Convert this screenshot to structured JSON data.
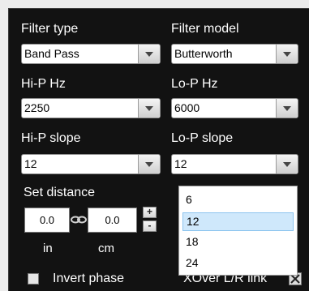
{
  "filter_type": {
    "label": "Filter type",
    "value": "Band Pass"
  },
  "filter_model": {
    "label": "Filter model",
    "value": "Butterworth"
  },
  "hip_hz": {
    "label": "Hi-P Hz",
    "value": "2250"
  },
  "lop_hz": {
    "label": "Lo-P Hz",
    "value": "6000"
  },
  "hip_slope": {
    "label": "Hi-P slope",
    "value": "12"
  },
  "lop_slope": {
    "label": "Lo-P slope",
    "value": "12",
    "options": [
      "6",
      "12",
      "18",
      "24"
    ],
    "selected": "12"
  },
  "distance": {
    "label": "Set distance",
    "in_value": "0.0",
    "cm_value": "0.0",
    "in_unit": "in",
    "cm_unit": "cm",
    "plus": "+",
    "minus": "-"
  },
  "invert_phase": {
    "label": "Invert phase",
    "checked": false
  },
  "xover_link": {
    "label": "XOver L/R link",
    "checked": true
  },
  "colors": {
    "panel_bg": "#121212",
    "text": "#ffffff",
    "selection": "#cfe8fb"
  },
  "icons": {
    "combo_arrow": "chevron-down-icon",
    "link": "chain-link-icon",
    "check": "checkmark-icon"
  }
}
